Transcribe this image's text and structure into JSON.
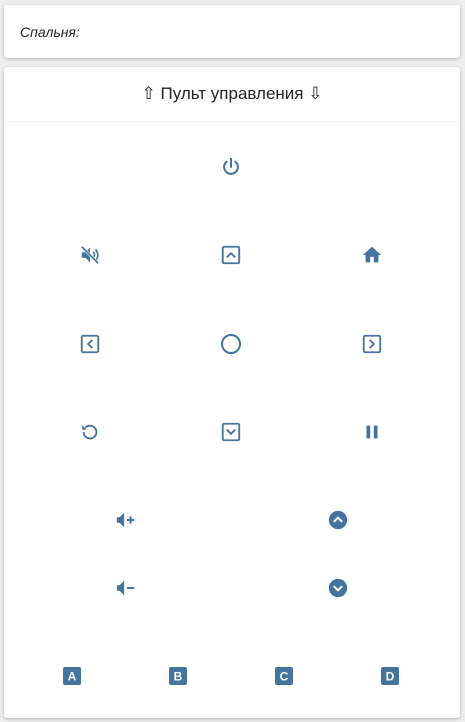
{
  "room": {
    "label": "Спальня:"
  },
  "remote": {
    "title": "⇧ Пульт управления ⇩",
    "buttons": {
      "power": "power-icon",
      "mute": "volume-off-icon",
      "up": "chevron-up-box-icon",
      "home": "home-icon",
      "left": "chevron-left-box-icon",
      "ok": "circle-outline-icon",
      "right": "chevron-right-box-icon",
      "replay": "replay-icon",
      "down": "chevron-down-box-icon",
      "pause": "pause-icon",
      "volume_up": "volume-plus-icon",
      "channel_up": "chevron-up-circle-icon",
      "volume_down": "volume-minus-icon",
      "channel_down": "chevron-down-circle-icon",
      "a": "A",
      "b": "B",
      "c": "C",
      "d": "D"
    },
    "icon_color": "#44739e"
  }
}
